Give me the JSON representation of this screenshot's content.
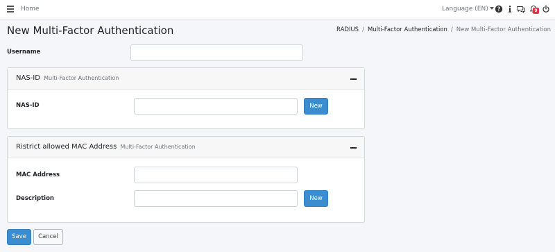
{
  "topbar": {
    "home_label": "Home",
    "language_label": "Language (EN)",
    "notification_count": "9"
  },
  "header": {
    "title": "New Multi-Factor Authentication",
    "breadcrumb": [
      "RADIUS",
      "Multi-Factor Authentication",
      "New Multi-Factor Authentication"
    ]
  },
  "form": {
    "username_label": "Username",
    "username_value": ""
  },
  "nas_card": {
    "title": "NAS-ID",
    "subtitle": "Multi-Factor Authentication",
    "field_label": "NAS-ID",
    "field_value": "",
    "new_button": "New"
  },
  "mac_card": {
    "title": "Ristrict allowed MAC Address",
    "subtitle": "Multi-Factor Authentication",
    "mac_label": "MAC Address",
    "mac_value": "",
    "description_label": "Description",
    "description_value": "",
    "new_button": "New"
  },
  "actions": {
    "save_label": "Save",
    "cancel_label": "Cancel"
  },
  "colors": {
    "primary": "#3c8dcf",
    "badge": "#dc3545",
    "background": "#f4f6f9"
  }
}
